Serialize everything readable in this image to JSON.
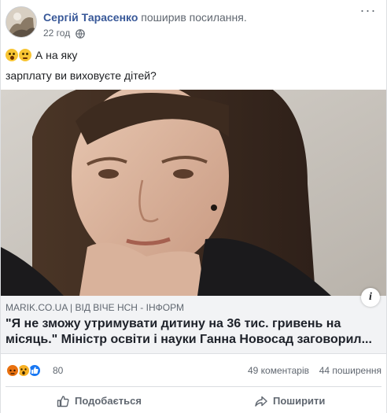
{
  "post": {
    "author": "Сергій Тарасенко",
    "action": "поширив посилання.",
    "time": "22 год",
    "text_line1": "А на яку",
    "text_line2": "зарплату ви виховуєте дітей?",
    "emojis": [
      "astonished-emoji",
      "thinking-emoji"
    ]
  },
  "link": {
    "source": "MARIK.CO.UA",
    "separator": "|",
    "via": "ВІД ВІЧЕ НСН - ІНФОРМ",
    "headline": "\"Я не зможу утримувати дитину на 36 тис. гривень на місяць.\" Міністр освіти і науки Ганна Новосад заговорил...",
    "info_label": "i"
  },
  "stats": {
    "reaction_count": "80",
    "reactions": [
      "angry",
      "wow",
      "like"
    ],
    "comments": "49 коментарів",
    "shares": "44 поширення"
  },
  "actions": {
    "like": "Подобається",
    "share": "Поширити"
  },
  "colors": {
    "author": "#385898",
    "secondary_text": "#606770",
    "link_bg": "#f2f3f5",
    "like_blue": "#1877f2",
    "angry_orange": "#e9710f",
    "wow_yellow": "#f7b125"
  }
}
